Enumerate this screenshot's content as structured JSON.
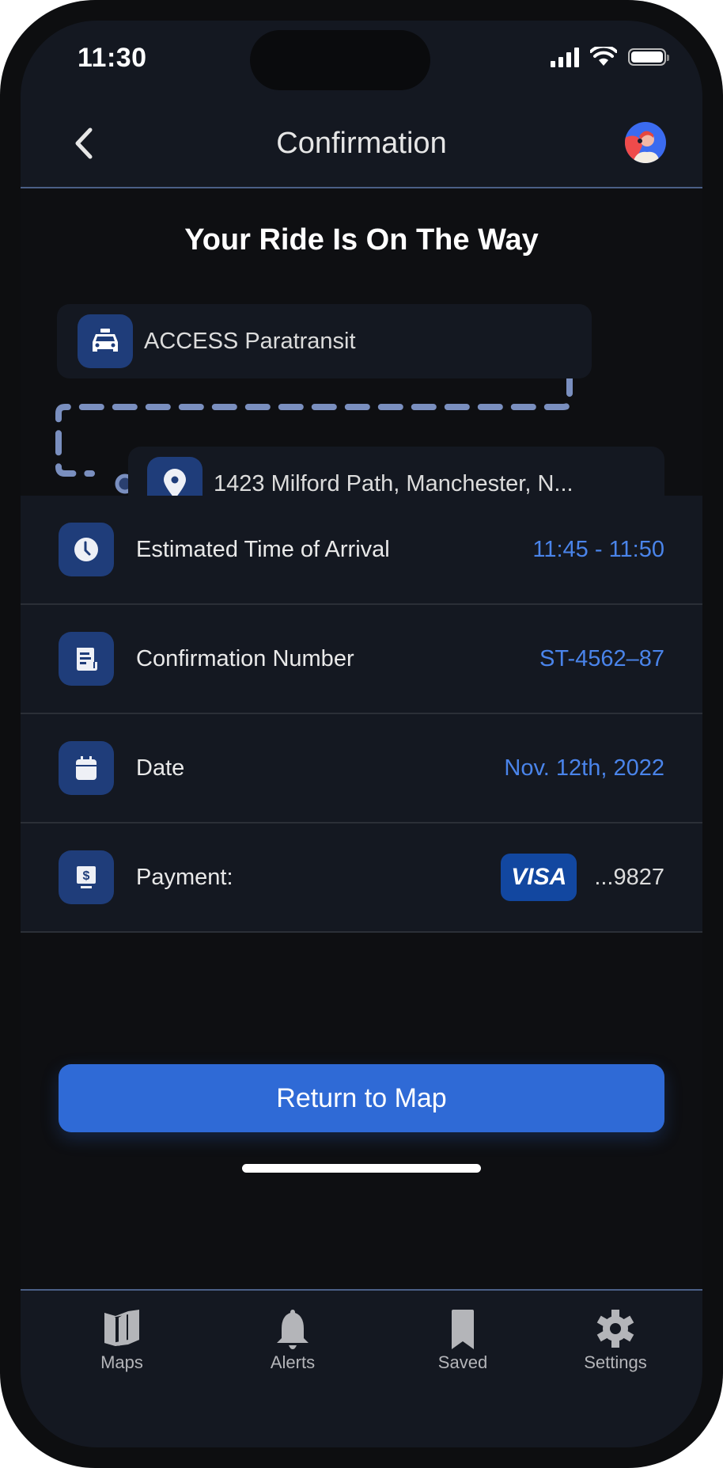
{
  "status_bar": {
    "time": "11:30"
  },
  "header": {
    "title": "Confirmation",
    "back_icon": "chevron-left-icon",
    "avatar": "user-avatar"
  },
  "heading": "Your Ride Is On The Way",
  "route": {
    "origin": {
      "icon": "taxi-icon",
      "label": "ACCESS Paratransit"
    },
    "destination": {
      "icon": "location-pin-icon",
      "label": "1423 Milford Path, Manchester, N..."
    },
    "line_color": "#7a8fbf"
  },
  "details": [
    {
      "icon": "clock-icon",
      "label": "Estimated Time of Arrival",
      "value": "11:45 - 11:50"
    },
    {
      "icon": "receipt-icon",
      "label": "Confirmation Number",
      "value": "ST-4562–87"
    },
    {
      "icon": "calendar-icon",
      "label": "Date",
      "value": "Nov. 12th, 2022"
    },
    {
      "icon": "payment-icon",
      "label": "Payment:",
      "card_brand": "VISA",
      "card_last4": "...9827"
    }
  ],
  "primary_button": {
    "label": "Return to Map"
  },
  "tabbar": {
    "items": [
      {
        "icon": "map-icon",
        "label": "Maps"
      },
      {
        "icon": "bell-icon",
        "label": "Alerts"
      },
      {
        "icon": "bookmark-icon",
        "label": "Saved"
      },
      {
        "icon": "gear-icon",
        "label": "Settings"
      }
    ]
  },
  "colors": {
    "accent": "#2f6ad6",
    "value_text": "#4a84ea",
    "icon_bg": "#1f3d7a",
    "surface": "#141821",
    "background": "#0e0f12"
  }
}
